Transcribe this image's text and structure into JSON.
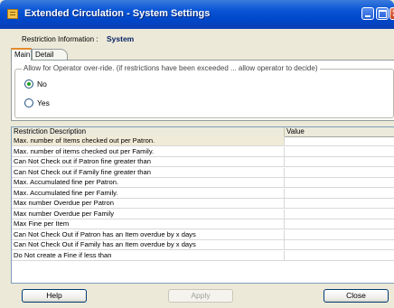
{
  "window": {
    "title": "Extended Circulation - System Settings"
  },
  "header": {
    "restriction_label": "Restriction Information :",
    "restriction_value": "System"
  },
  "tabs": [
    {
      "label": "Main",
      "selected": true
    },
    {
      "label": "Detail",
      "selected": false
    }
  ],
  "override_group": {
    "title": "Allow for Operator over-ride.  (if restrictions have been exceeded ... allow operator to decide)",
    "options": [
      {
        "label": "No",
        "selected": true
      },
      {
        "label": "Yes",
        "selected": false
      }
    ]
  },
  "grid": {
    "columns": [
      "Restriction Description",
      "Value"
    ],
    "rows": [
      {
        "description": "Max. number of Items checked out per Patron.",
        "value": ""
      },
      {
        "description": "Max. number of items checked out per Family.",
        "value": ""
      },
      {
        "description": "Can Not Check out if Patron fine greater than",
        "value": ""
      },
      {
        "description": "Can Not Check out if Family fine greater than",
        "value": ""
      },
      {
        "description": "Max. Accumulated fine per Patron.",
        "value": ""
      },
      {
        "description": "Max. Accumulated fine per Family.",
        "value": ""
      },
      {
        "description": "Max number Overdue per Patron",
        "value": ""
      },
      {
        "description": "Max number Overdue per Family",
        "value": ""
      },
      {
        "description": "Max Fine per Item",
        "value": ""
      },
      {
        "description": "Can Not Check Out if Patron has an Item overdue by x days",
        "value": ""
      },
      {
        "description": "Can Not Check Out if Family has an Item overdue by x days",
        "value": ""
      },
      {
        "description": "Do Not create a Fine if less than",
        "value": ""
      }
    ]
  },
  "buttons": {
    "help": "Help",
    "apply": "Apply",
    "close": "Close"
  },
  "colors": {
    "titlebar": "#0a55d6",
    "selected_radio": "#21a121",
    "first_row_highlight": "#f0ebd6"
  }
}
